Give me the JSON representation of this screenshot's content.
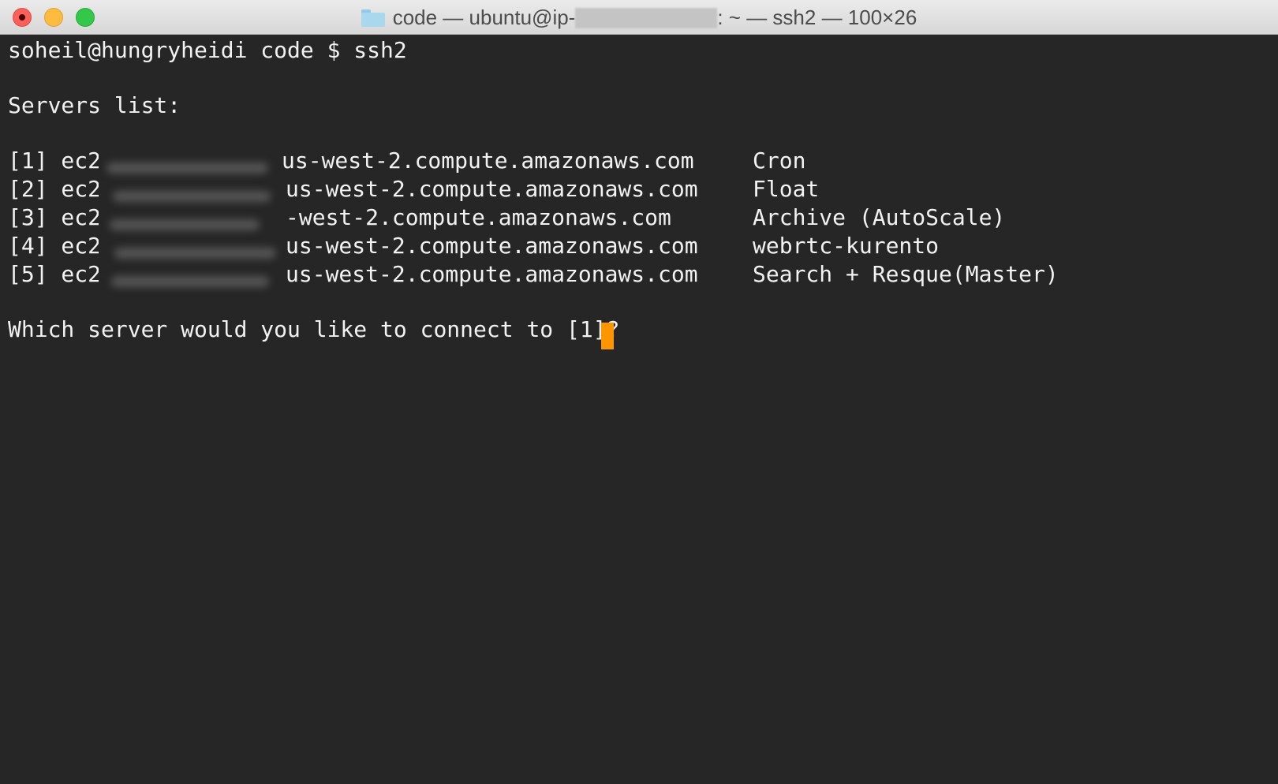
{
  "window": {
    "title_prefix": "code — ubuntu@ip-",
    "title_suffix": ": ~ — ssh2 — 100×26",
    "title_redacted": true
  },
  "terminal": {
    "prompt_line": "soheil@hungryheidi code $ ssh2",
    "list_heading": "Servers list:",
    "servers": [
      {
        "index": "[1] ec2",
        "host_tail": "us-west-2.compute.amazonaws.com",
        "label": "Cron"
      },
      {
        "index": "[2] ec2",
        "host_tail": "us-west-2.compute.amazonaws.com",
        "label": "Float"
      },
      {
        "index": "[3] ec2",
        "host_tail": "-west-2.compute.amazonaws.com",
        "label": "Archive (AutoScale)"
      },
      {
        "index": "[4] ec2",
        "host_tail": "us-west-2.compute.amazonaws.com",
        "label": "webrtc-kurento"
      },
      {
        "index": "[5] ec2",
        "host_tail": "us-west-2.compute.amazonaws.com",
        "label": "Search + Resque(Master)"
      }
    ],
    "question": "Which server would you like to connect to [1]? ",
    "cursor_color": "#ff9500"
  },
  "colors": {
    "background": "#262626",
    "text": "#f2f2f2",
    "close": "#fc605b",
    "minimize": "#fdbc40",
    "maximize": "#34c84a"
  }
}
